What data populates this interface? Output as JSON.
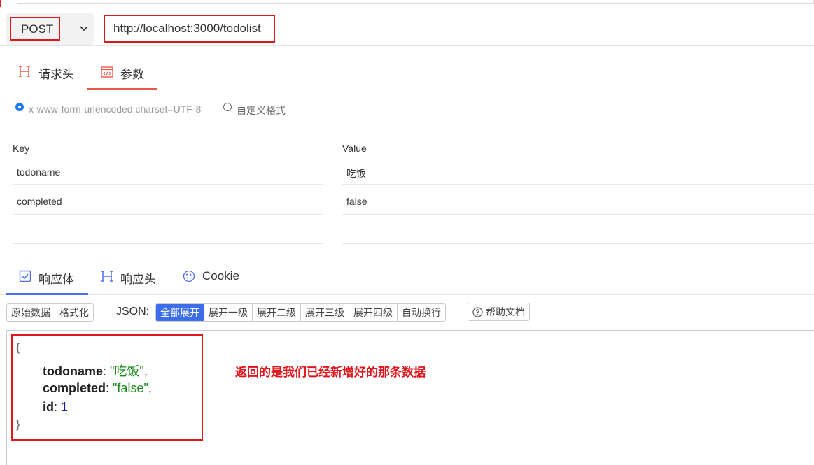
{
  "request": {
    "method": "POST",
    "url": "http://localhost:3000/todolist"
  },
  "request_tabs": [
    {
      "label": "请求头",
      "icon": "h-icon"
    },
    {
      "label": "参数",
      "icon": "code-icon",
      "active": true
    }
  ],
  "body_type": {
    "options": [
      {
        "label": "x-www-form-urlencoded;charset=UTF-8",
        "selected": true
      },
      {
        "label": "自定义格式",
        "selected": false
      }
    ]
  },
  "params": {
    "key_header": "Key",
    "value_header": "Value",
    "rows": [
      {
        "key": "todoname",
        "value": "吃饭"
      },
      {
        "key": "completed",
        "value": "false"
      }
    ]
  },
  "response_tabs": [
    {
      "label": "响应体",
      "icon": "check-square-icon",
      "active": true
    },
    {
      "label": "响应头",
      "icon": "h-icon"
    },
    {
      "label": "Cookie",
      "icon": "cookie-icon"
    }
  ],
  "toolbar": {
    "view_buttons": [
      "原始数据",
      "格式化"
    ],
    "json_label": "JSON:",
    "expand_buttons": [
      "全部展开",
      "展开一级",
      "展开二级",
      "展开三级",
      "展开四级",
      "自动换行"
    ],
    "active_expand": "全部展开",
    "help_label": "帮助文档"
  },
  "response": {
    "open_brace": "{",
    "close_brace": "}",
    "fields": [
      {
        "key": "todoname",
        "value": "\"吃饭\"",
        "type": "string",
        "suffix": ","
      },
      {
        "key": "completed",
        "value": "\"false\"",
        "type": "string",
        "suffix": ","
      },
      {
        "key": "id",
        "value": "1",
        "type": "number",
        "suffix": ""
      }
    ]
  },
  "annotation": "返回的是我们已经新增好的那条数据",
  "colors": {
    "highlight_red": "#e0161d",
    "tab_accent": "#ea5a4a",
    "response_accent": "#4c6ef5",
    "active_button": "#3b6ee8"
  }
}
